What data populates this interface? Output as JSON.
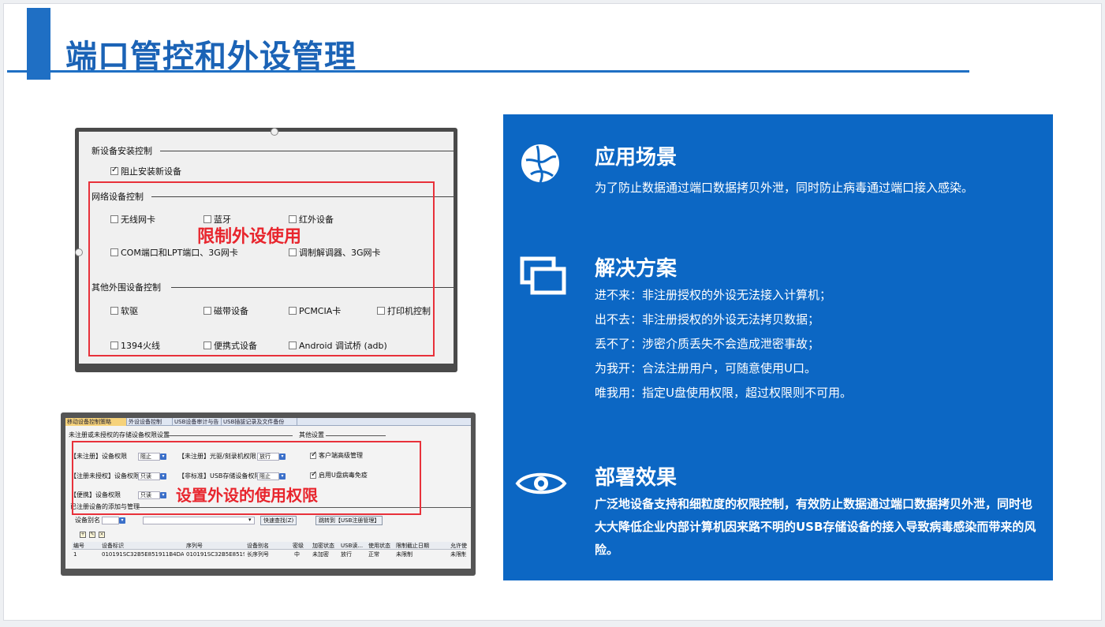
{
  "page": {
    "title": "端口管控和外设管理"
  },
  "colors": {
    "accent": "#1f6fc4",
    "panel": "#0c67c4",
    "highlight": "#e8313a"
  },
  "shot1": {
    "group_new": "新设备安装控制",
    "block_new": "阻止安装新设备",
    "group_network": "网络设备控制",
    "network_items": [
      "无线网卡",
      "蓝牙",
      "红外设备",
      "COM端口和LPT端口、3G网卡",
      "调制解调器、3G网卡"
    ],
    "group_other": "其他外围设备控制",
    "other_items": [
      "软驱",
      "磁带设备",
      "PCMCIA卡",
      "打印机控制",
      "1394火线",
      "便携式设备",
      "Android 调试桥 (adb)"
    ],
    "annotation": "限制外设使用"
  },
  "shot2": {
    "tabs": [
      "移动设备控制策略",
      "外设设备控制",
      "USB设备审计与告警",
      "USB插拔记录及文件备份"
    ],
    "group_storage": "未注册或未授权的存储设备权限设置",
    "group_other": "其他设置",
    "rows": [
      {
        "label": "【未注册】设备权限",
        "value": "阻止"
      },
      {
        "label": "【注册未授权】设备权限",
        "value": "只读"
      },
      {
        "label": "【便携】设备权限",
        "value": "只读"
      }
    ],
    "rows2": [
      {
        "label": "【未注册】光驱/刻录机权限",
        "value": "放行"
      },
      {
        "label": "【非标准】USB存储设备权限",
        "value": "阻止"
      }
    ],
    "checks": [
      "客户端高级管理",
      "启用U盘病毒免疫"
    ],
    "group_registered": "已注册设备的添加与管理",
    "filter_field": "设备别名",
    "btn_search": "快速查找(Z)",
    "btn_jump": "跳转到【USB注册管理】",
    "table_headers": [
      "编号",
      "设备标识",
      "序列号",
      "设备别名",
      "密级",
      "加密状态",
      "USB读...",
      "使用状态",
      "限制截止日期",
      "允许使"
    ],
    "table_row": [
      "1",
      "010191SC32B5E851911B4DAD9...",
      "010191SC32B5E8519...",
      "长序列号",
      "中",
      "未加密",
      "放行",
      "正常",
      "未限制",
      "未限制"
    ],
    "annotation": "设置外设的使用权限"
  },
  "panel": {
    "scene_title": "应用场景",
    "scene_text": "为了防止数据通过端口数据拷贝外泄，同时防止病毒通过端口接入感染。",
    "solution_title": "解决方案",
    "solution_lines": [
      "进不来：非注册授权的外设无法接入计算机；",
      "出不去：非注册授权的外设无法拷贝数据；",
      "丢不了：涉密介质丢失不会造成泄密事故；",
      "为我开：合法注册用户，可随意使用U口。",
      "唯我用：指定U盘使用权限，超过权限则不可用。"
    ],
    "effect_title": "部署效果",
    "effect_text": "广泛地设备支持和细粒度的权限控制，有效防止数据通过端口数据拷贝外泄，同时也大大降低企业内部计算机因来路不明的USB存储设备的接入导致病毒感染而带来的风险。",
    "icons": [
      "globe-icon",
      "windows-icon",
      "eye-icon"
    ]
  }
}
